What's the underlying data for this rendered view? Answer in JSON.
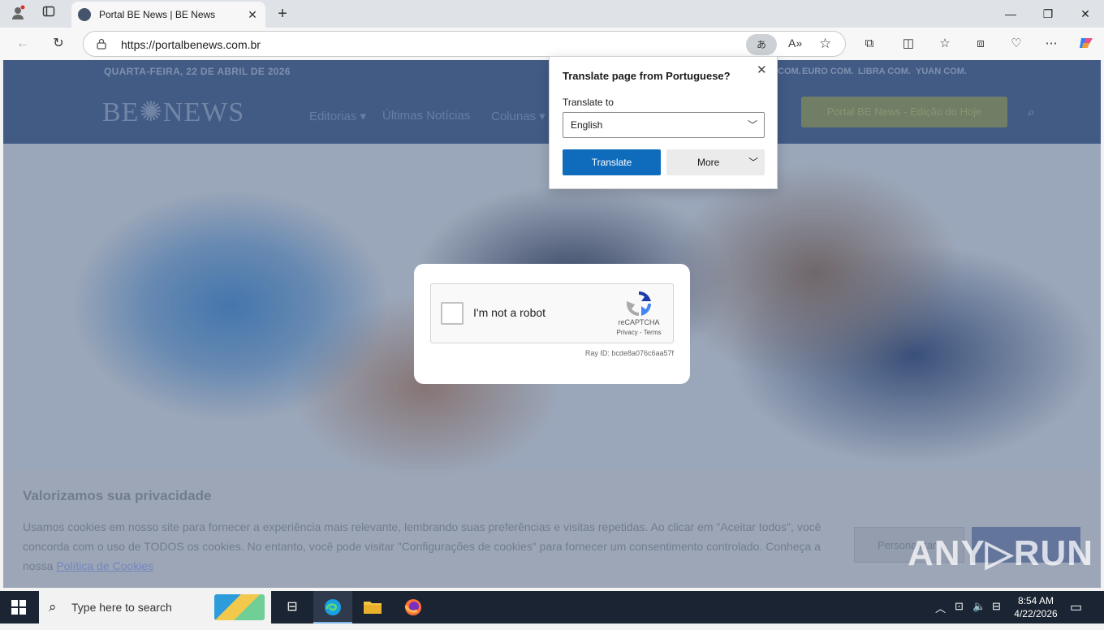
{
  "browser": {
    "tab_title": "Portal BE News | BE News",
    "url": "https://portalbenews.com.br",
    "translate_icon": "あ",
    "read_aloud_icon": "A»"
  },
  "site": {
    "date": "QUARTA-FEIRA, 22 DE ABRIL DE 2026",
    "currencies": [
      "COM.",
      "EURO COM.",
      "LIBRA COM.",
      "YUAN COM."
    ],
    "logo": "BE✺NEWS",
    "menu": [
      "Editorias ▾",
      "Últimas Notícias",
      "Colunas ▾"
    ],
    "edition_button": "Portal BE News - Edição do Hoje"
  },
  "cookie": {
    "title": "Valorizamos sua privacidade",
    "text": "Usamos cookies em nosso site para fornecer a experiência mais relevante, lembrando suas preferências e visitas repetidas. Ao clicar em \"Aceitar todos\", você concorda com o uso de TODOS os cookies. No entanto, você pode visitar \"Configurações de cookies\" para fornecer um consentimento controlado. Conheça a nossa",
    "link": "Política de Cookies",
    "settings_button": "Personalizar"
  },
  "captcha": {
    "label": "I'm not a robot",
    "brand": "reCAPTCHA",
    "links": "Privacy - Terms",
    "ray_id": "Ray ID: bcde8a076c6aa57f"
  },
  "translate_popup": {
    "title": "Translate page from Portuguese?",
    "translate_to_label": "Translate to",
    "language": "English",
    "translate_button": "Translate",
    "more_button": "More"
  },
  "watermark": "ANY▷RUN",
  "taskbar": {
    "search_placeholder": "Type here to search",
    "time": "8:54 AM",
    "date": "4/22/2026"
  }
}
